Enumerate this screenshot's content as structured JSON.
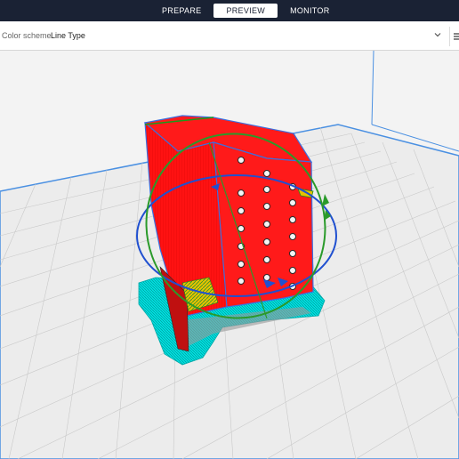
{
  "header": {
    "tabs": [
      {
        "label": "PREPARE",
        "active": false
      },
      {
        "label": "PREVIEW",
        "active": true
      },
      {
        "label": "MONITOR",
        "active": false
      }
    ]
  },
  "preview_bar": {
    "color_scheme_label": "Color scheme",
    "color_scheme_value": "Line Type"
  },
  "colors": {
    "topbar": "#1a2234",
    "wall": "#ff1a1a",
    "support": "#00e0e0",
    "infill": "#e6c200",
    "build_plate": "#ededed",
    "edge": "#4a90e2",
    "rotate_ring_blue": "#2050d0",
    "rotate_ring_green": "#2a9a2a"
  },
  "icons": {
    "dropdown": "chevron-down-icon",
    "panel": "panel-toggle-icon"
  }
}
